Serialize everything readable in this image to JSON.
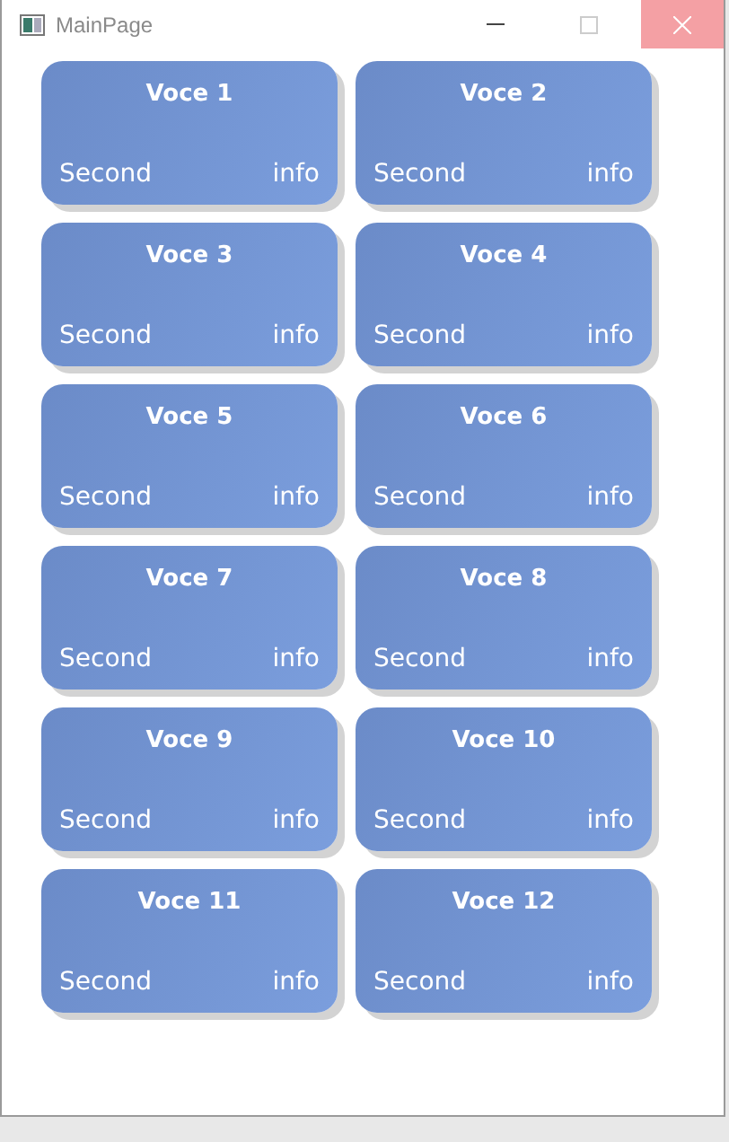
{
  "window": {
    "title": "MainPage"
  },
  "cards": [
    {
      "title": "Voce 1",
      "left": "Second",
      "right": "info"
    },
    {
      "title": "Voce 2",
      "left": "Second",
      "right": "info"
    },
    {
      "title": "Voce 3",
      "left": "Second",
      "right": "info"
    },
    {
      "title": "Voce 4",
      "left": "Second",
      "right": "info"
    },
    {
      "title": "Voce 5",
      "left": "Second",
      "right": "info"
    },
    {
      "title": "Voce 6",
      "left": "Second",
      "right": "info"
    },
    {
      "title": "Voce 7",
      "left": "Second",
      "right": "info"
    },
    {
      "title": "Voce 8",
      "left": "Second",
      "right": "info"
    },
    {
      "title": "Voce 9",
      "left": "Second",
      "right": "info"
    },
    {
      "title": "Voce 10",
      "left": "Second",
      "right": "info"
    },
    {
      "title": "Voce 11",
      "left": "Second",
      "right": "info"
    },
    {
      "title": "Voce 12",
      "left": "Second",
      "right": "info"
    }
  ]
}
